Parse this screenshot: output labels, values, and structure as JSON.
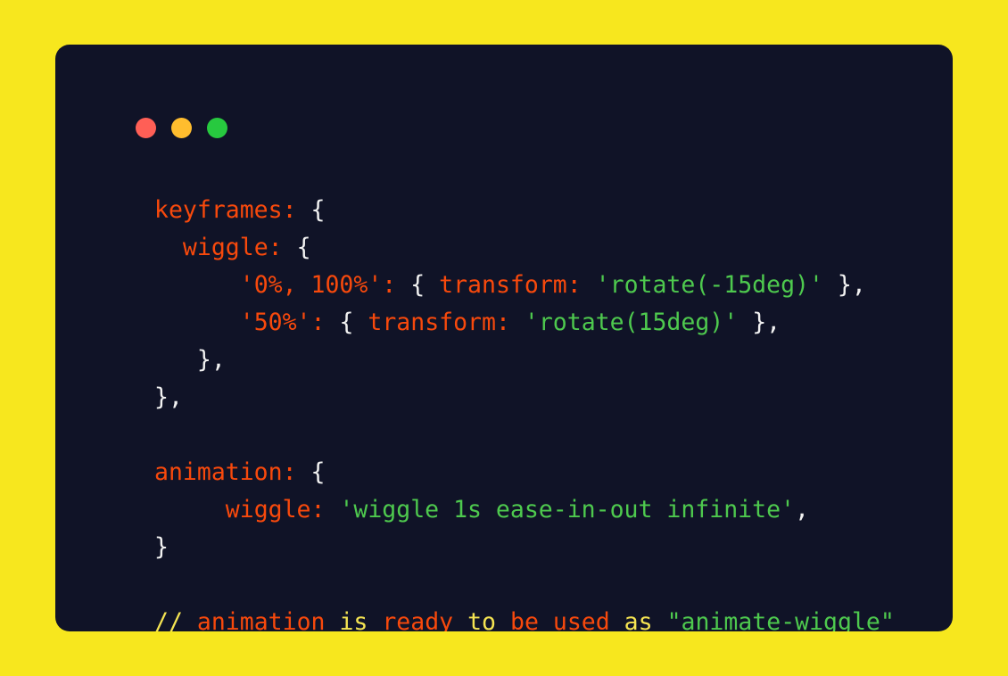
{
  "theme": {
    "page_background": "#f7e71e",
    "card_background": "#101327",
    "keyword_color": "#f8490c",
    "string_color": "#4ec94e",
    "punctuation_color": "#f2f2f2",
    "comment_yellow": "#f5e452",
    "comment_orange": "#f8490c"
  },
  "window_controls": {
    "close": {
      "name": "close-dot",
      "color": "#ff5f56"
    },
    "minimize": {
      "name": "minimize-dot",
      "color": "#ffbd2e"
    },
    "maximize": {
      "name": "maximize-dot",
      "color": "#27c93f"
    }
  },
  "code": {
    "language": "javascript",
    "plain_text": "keyframes: {\n  wiggle: {\n      '0%, 100%': { transform: 'rotate(-15deg)' },\n      '50%': { transform: 'rotate(15deg)' },\n   },\n},\n\nanimation: {\n     wiggle: 'wiggle 1s ease-in-out infinite',\n}\n\n// animation is ready to be used as \"animate-wiggle\"",
    "lines": [
      {
        "indent": "",
        "tokens": [
          {
            "text": "keyframes:",
            "type": "key"
          },
          {
            "text": " ",
            "type": "plain"
          },
          {
            "text": "{",
            "type": "punct"
          }
        ]
      },
      {
        "indent": "  ",
        "tokens": [
          {
            "text": "wiggle:",
            "type": "key"
          },
          {
            "text": " ",
            "type": "plain"
          },
          {
            "text": "{",
            "type": "punct"
          }
        ]
      },
      {
        "indent": "      ",
        "tokens": [
          {
            "text": "'0%, 100%':",
            "type": "key"
          },
          {
            "text": " ",
            "type": "plain"
          },
          {
            "text": "{",
            "type": "punct"
          },
          {
            "text": " ",
            "type": "plain"
          },
          {
            "text": "transform:",
            "type": "key"
          },
          {
            "text": " ",
            "type": "plain"
          },
          {
            "text": "'rotate(-15deg)'",
            "type": "string"
          },
          {
            "text": " ",
            "type": "plain"
          },
          {
            "text": "},",
            "type": "punct"
          }
        ]
      },
      {
        "indent": "      ",
        "tokens": [
          {
            "text": "'50%':",
            "type": "key"
          },
          {
            "text": " ",
            "type": "plain"
          },
          {
            "text": "{",
            "type": "punct"
          },
          {
            "text": " ",
            "type": "plain"
          },
          {
            "text": "transform:",
            "type": "key"
          },
          {
            "text": " ",
            "type": "plain"
          },
          {
            "text": "'rotate(15deg)'",
            "type": "string"
          },
          {
            "text": " ",
            "type": "plain"
          },
          {
            "text": "},",
            "type": "punct"
          }
        ]
      },
      {
        "indent": "   ",
        "tokens": [
          {
            "text": "},",
            "type": "punct"
          }
        ]
      },
      {
        "indent": "",
        "tokens": [
          {
            "text": "},",
            "type": "punct"
          }
        ]
      },
      {
        "indent": "",
        "tokens": []
      },
      {
        "indent": "",
        "tokens": [
          {
            "text": "animation:",
            "type": "key"
          },
          {
            "text": " ",
            "type": "plain"
          },
          {
            "text": "{",
            "type": "punct"
          }
        ]
      },
      {
        "indent": "     ",
        "tokens": [
          {
            "text": "wiggle:",
            "type": "key"
          },
          {
            "text": " ",
            "type": "plain"
          },
          {
            "text": "'wiggle 1s ease-in-out infinite'",
            "type": "string"
          },
          {
            "text": ",",
            "type": "punct"
          }
        ]
      },
      {
        "indent": "",
        "tokens": [
          {
            "text": "}",
            "type": "punct"
          }
        ]
      },
      {
        "indent": "",
        "tokens": []
      },
      {
        "indent": "",
        "tokens": [
          {
            "text": "//",
            "type": "yellow"
          },
          {
            "text": " ",
            "type": "plain"
          },
          {
            "text": "animation",
            "type": "orange"
          },
          {
            "text": " ",
            "type": "plain"
          },
          {
            "text": "is",
            "type": "yellow"
          },
          {
            "text": " ",
            "type": "plain"
          },
          {
            "text": "ready",
            "type": "orange"
          },
          {
            "text": " ",
            "type": "plain"
          },
          {
            "text": "to",
            "type": "yellow"
          },
          {
            "text": " ",
            "type": "plain"
          },
          {
            "text": "be",
            "type": "orange"
          },
          {
            "text": " ",
            "type": "plain"
          },
          {
            "text": "used",
            "type": "orange"
          },
          {
            "text": " ",
            "type": "plain"
          },
          {
            "text": "as",
            "type": "yellow"
          },
          {
            "text": " ",
            "type": "plain"
          },
          {
            "text": "\"animate-wiggle\"",
            "type": "string"
          }
        ]
      }
    ]
  }
}
